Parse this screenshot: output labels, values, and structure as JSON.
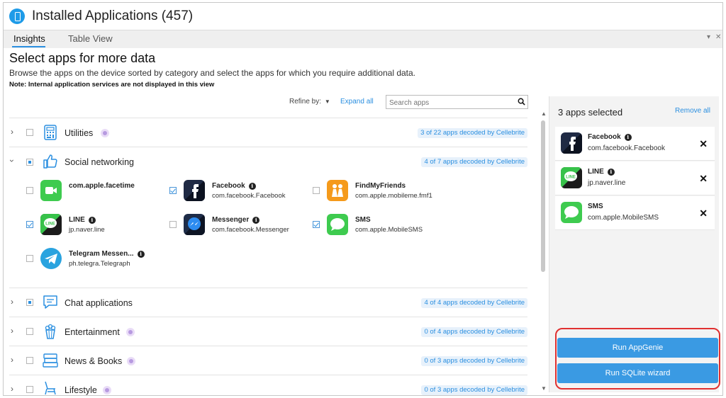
{
  "window": {
    "title": "Installed Applications (457)"
  },
  "tabs": [
    {
      "label": "Insights",
      "active": true
    },
    {
      "label": "Table View",
      "active": false
    }
  ],
  "tab_controls": {
    "dropdown": "▾",
    "close": "✕"
  },
  "header": {
    "heading": "Select apps for more data",
    "description": "Browse the apps on the device sorted by category and select the apps for which you require additional data.",
    "note": "Note: Internal application services are not displayed in this view"
  },
  "toolbar": {
    "refine_label": "Refine by:",
    "expand_all": "Expand all",
    "search_placeholder": "Search apps"
  },
  "categories": [
    {
      "name": "Utilities",
      "badge": "3 of 22 apps decoded by Cellebrite",
      "expanded": false,
      "icon": "calculator-icon"
    },
    {
      "name": "Social networking",
      "badge": "4 of 7 apps decoded by Cellebrite",
      "expanded": true,
      "icon": "thumbs-up-icon"
    },
    {
      "name": "Chat applications",
      "badge": "4 of 4 apps decoded by Cellebrite",
      "expanded": false,
      "icon": "chat-icon"
    },
    {
      "name": "Entertainment",
      "badge": "0 of 4 apps decoded by Cellebrite",
      "expanded": false,
      "icon": "popcorn-icon"
    },
    {
      "name": "News & Books",
      "badge": "0 of 3 apps decoded by Cellebrite",
      "expanded": false,
      "icon": "books-icon"
    },
    {
      "name": "Lifestyle",
      "badge": "0 of 3 apps decoded by Cellebrite",
      "expanded": false,
      "icon": "chair-icon"
    }
  ],
  "social_apps": [
    {
      "title": "com.apple.facetime",
      "sub": "",
      "checked": false,
      "info": false,
      "icon": "facetime-icon"
    },
    {
      "title": "Facebook",
      "sub": "com.facebook.Facebook",
      "checked": true,
      "info": true,
      "icon": "facebook-icon"
    },
    {
      "title": "FindMyFriends",
      "sub": "com.apple.mobileme.fmf1",
      "checked": false,
      "info": false,
      "icon": "find-my-friends-icon"
    },
    {
      "title": "LINE",
      "sub": "jp.naver.line",
      "checked": true,
      "info": true,
      "icon": "line-icon"
    },
    {
      "title": "Messenger",
      "sub": "com.facebook.Messenger",
      "checked": false,
      "info": true,
      "icon": "messenger-icon"
    },
    {
      "title": "SMS",
      "sub": "com.apple.MobileSMS",
      "checked": true,
      "info": false,
      "icon": "sms-icon"
    },
    {
      "title": "Telegram Messen...",
      "sub": "ph.telegra.Telegraph",
      "checked": false,
      "info": true,
      "icon": "telegram-icon"
    }
  ],
  "panel": {
    "title": "3 apps selected",
    "remove_all": "Remove all",
    "selected": [
      {
        "title": "Facebook",
        "sub": "com.facebook.Facebook",
        "info": true,
        "icon": "facebook-icon"
      },
      {
        "title": "LINE",
        "sub": "jp.naver.line",
        "info": true,
        "icon": "line-icon"
      },
      {
        "title": "SMS",
        "sub": "com.apple.MobileSMS",
        "info": false,
        "icon": "sms-icon"
      }
    ],
    "close_glyph": "✕"
  },
  "actions": {
    "run_appgenie": "Run AppGenie",
    "run_sqlite": "Run SQLite wizard"
  },
  "colors": {
    "accent": "#2b8fe0",
    "button": "#3a9ae3",
    "highlight_border": "#e03030"
  }
}
